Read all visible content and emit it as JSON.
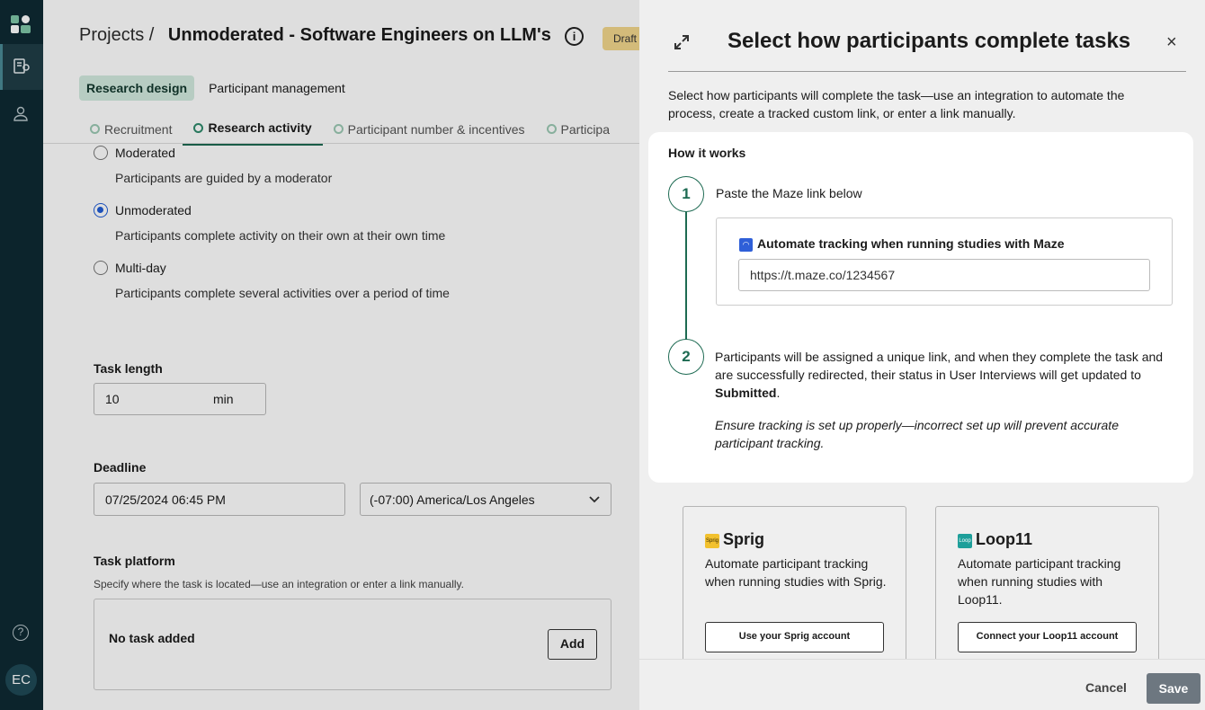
{
  "rail": {
    "avatar_initials": "EC",
    "help_glyph": "?",
    "icons": [
      "logo-icon",
      "research-icon",
      "user-icon"
    ]
  },
  "page": {
    "breadcrumb_root": "Projects /",
    "project_title": "Unmoderated - Software Engineers on LLM's",
    "status_badge": "Draft",
    "top_tabs": [
      {
        "label": "Research design",
        "active": true
      },
      {
        "label": "Participant management",
        "active": false
      }
    ],
    "step_tabs": [
      {
        "label": "Recruitment",
        "active": false
      },
      {
        "label": "Research activity",
        "active": true
      },
      {
        "label": "Participant number & incentives",
        "active": false
      },
      {
        "label": "Participa",
        "active": false
      }
    ],
    "modes": [
      {
        "label": "Moderated",
        "desc": "Participants are guided by a moderator",
        "selected": false
      },
      {
        "label": "Unmoderated",
        "desc": "Participants complete activity on their own at their own time",
        "selected": true
      },
      {
        "label": "Multi-day",
        "desc": "Participants complete several activities over a period of time",
        "selected": false
      }
    ],
    "task_length": {
      "label": "Task length",
      "value": "10",
      "unit": "min"
    },
    "deadline": {
      "label": "Deadline",
      "date": "07/25/2024 06:45 PM",
      "timezone": "(-07:00) America/Los Angeles"
    },
    "task_platform": {
      "label": "Task platform",
      "hint": "Specify where the task is located—use an integration or enter a link manually.",
      "empty": "No task added",
      "add_label": "Add"
    }
  },
  "drawer": {
    "title": "Select how participants complete tasks",
    "close_glyph": "×",
    "intro": "Select how participants will complete the task—use an integration to automate the process, create a tracked custom link, or enter a link manually.",
    "how_it_works": "How it works",
    "step1": {
      "num": "1",
      "text": "Paste the Maze link below"
    },
    "maze": {
      "title": "Automate tracking when running studies with Maze",
      "url": "https://t.maze.co/1234567"
    },
    "step2": {
      "num": "2",
      "text_before": "Participants will be assigned a unique link, and when they complete the task and are successfully redirected, their status in User Interviews will get updated to ",
      "bold": "Submitted",
      "text_after": ".",
      "note": "Ensure tracking is set up properly—incorrect set up will prevent accurate participant tracking."
    },
    "providers": [
      {
        "name": "Sprig",
        "icon_text": "Sprig",
        "icon_color": "#f2c12e",
        "desc": "Automate participant tracking when running studies with Sprig.",
        "button": "Use your Sprig account"
      },
      {
        "name": "Loop11",
        "icon_text": "Loop",
        "icon_color": "#1e9f9a",
        "desc": "Automate participant tracking when running studies with Loop11.",
        "button": "Connect your Loop11 account"
      }
    ],
    "cancel_label": "Cancel",
    "save_label": "Save"
  }
}
